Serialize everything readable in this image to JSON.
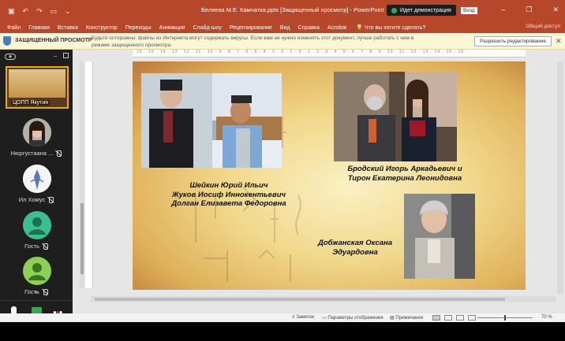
{
  "titlebar": {
    "title": "Беляева М.Е. Камчатка.pptx [Защищенный просмотр] - PowerPoint",
    "demo_label": "Идет демонстрация",
    "login_label": "Вход",
    "color": "#b7472a"
  },
  "ribbon_tabs": [
    "Файл",
    "Главная",
    "Вставка",
    "Конструктор",
    "Переходы",
    "Анимация",
    "Слайд-шоу",
    "Рецензирование",
    "Вид",
    "Справка",
    "Acrobat"
  ],
  "tell_me": "Что вы хотите сделать?",
  "share": "Общий доступ",
  "protected": {
    "title": "ЗАЩИЩЕННЫЙ ПРОСМОТР",
    "message": "Будьте осторожны: файлы из Интернета могут содержать вирусы. Если вам не нужно изменять этот документ, лучше работать с ним в режиме защищенного просмотра.",
    "button": "Разрешить редактирование"
  },
  "participants": {
    "active_label": "ЦОПП Якутия",
    "items": [
      {
        "name": "Нюргустаана ...",
        "icon": "person-photo"
      },
      {
        "name": "Ил Хомус",
        "icon": "emblem-avatar"
      },
      {
        "name": "Гость",
        "icon": "default-avatar"
      },
      {
        "name": "Гость",
        "icon": "default-avatar"
      }
    ]
  },
  "slide": {
    "caption1": [
      "Шейкин Юрий Ильич",
      "Жуков Иосиф Иннокентьевич",
      "Долган Елизавета Федоровна"
    ],
    "caption2": [
      "Бродский Игорь Аркадьевич и",
      "Тирон Екатерина Леонидовна"
    ],
    "caption3": [
      "Добжанская Оксана",
      "Эдуардовна"
    ]
  },
  "status": {
    "notes": "Заметки",
    "display_settings": "Параметры отображения",
    "comments": "Примечания",
    "zoom": "70 %"
  }
}
